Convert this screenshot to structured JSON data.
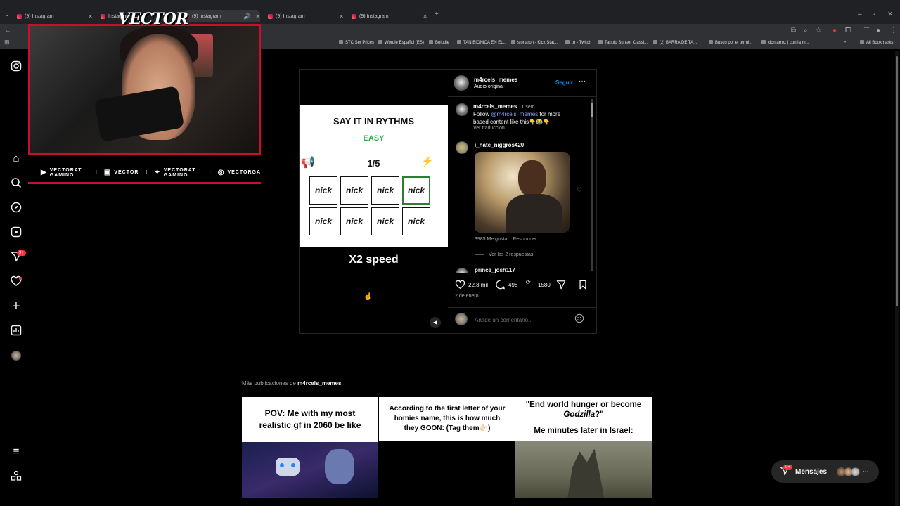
{
  "browser": {
    "tabs": [
      {
        "label": "(9) Instagram"
      },
      {
        "label": "Instagram"
      },
      {
        "label": "(9) Instagram"
      },
      {
        "label": "(9) Instagram"
      },
      {
        "label": "(9) Instagram"
      }
    ],
    "new_tab": "+",
    "bookmarks": [
      "STC Set Prices",
      "Wordle Español (ES)",
      "Boludle",
      "TAN BIONICA EN EL...",
      "sionaron - Kick Stat...",
      "trr - Twitch",
      "Tanulo Sunset Classi...",
      "(2) BARRA DE TA...",
      "Buscó por el térmi...",
      "cicn arroz | con la m..."
    ],
    "all_bookmarks": "All Bookmarks"
  },
  "sidebar": {
    "icons": [
      "instagram-logo-icon",
      "home-icon",
      "search-icon",
      "explore-icon",
      "reels-icon",
      "direct-icon",
      "heart-icon",
      "create-icon",
      "dashboard-icon",
      "profile-avatar",
      "menu-icon",
      "more-icon"
    ],
    "badge": "9+"
  },
  "overlay": {
    "logo": "VECTOR",
    "socials": [
      {
        "icon": "youtube-icon",
        "label": "VECTORAT GAMING"
      },
      {
        "icon": "twitch-icon",
        "label": "VECTOR"
      },
      {
        "icon": "twitter-icon",
        "label": "VECTORAT GAMING"
      },
      {
        "icon": "instagram-icon",
        "label": "VECTORGA"
      }
    ]
  },
  "post": {
    "media": {
      "title": "SAY IT IN RYTHMS",
      "difficulty": "EASY",
      "counter": "1/5",
      "cells": [
        "nick",
        "nick",
        "nick",
        "nick",
        "nick",
        "nick",
        "nick",
        "nick"
      ],
      "speed": "X2 speed"
    },
    "author": "m4rcels_memes",
    "audio": "Audio original",
    "follow": "Seguir",
    "caption": {
      "user": "m4rcels_memes",
      "time": "1 sem",
      "text_pre": "Follow ",
      "mention": "@m4rcels_memes",
      "text_post": " for more based content like this👇😂👇",
      "translate": "Ver traducción"
    },
    "comment": {
      "user": "i_hate_niggros420",
      "likes": "3985 Me gusta",
      "reply": "Responder",
      "view_replies": "Ver las 2 respuestas"
    },
    "next_user": "prince_josh117",
    "stats": {
      "likes": "22,8 mil",
      "comments": "498",
      "reposts": "1580"
    },
    "date": "2 de enero",
    "comment_placeholder": "Añade un comentario..."
  },
  "more": {
    "label": "Más publicaciones de",
    "user": "m4rcels_memes",
    "thumbs": [
      {
        "caption": "POV: Me with my most realistic gf in 2060 be like"
      },
      {
        "caption": "According to the first letter of your homies name, this is how much they GOON: (Tag them👉🏻)"
      },
      {
        "caption_a": "\"End world hunger or become ",
        "caption_em": "Godzilla",
        "caption_b": "?\"",
        "caption_2": "Me minutes later in Israel:"
      }
    ]
  },
  "messages": {
    "label": "Mensajes",
    "badge": "9+"
  }
}
